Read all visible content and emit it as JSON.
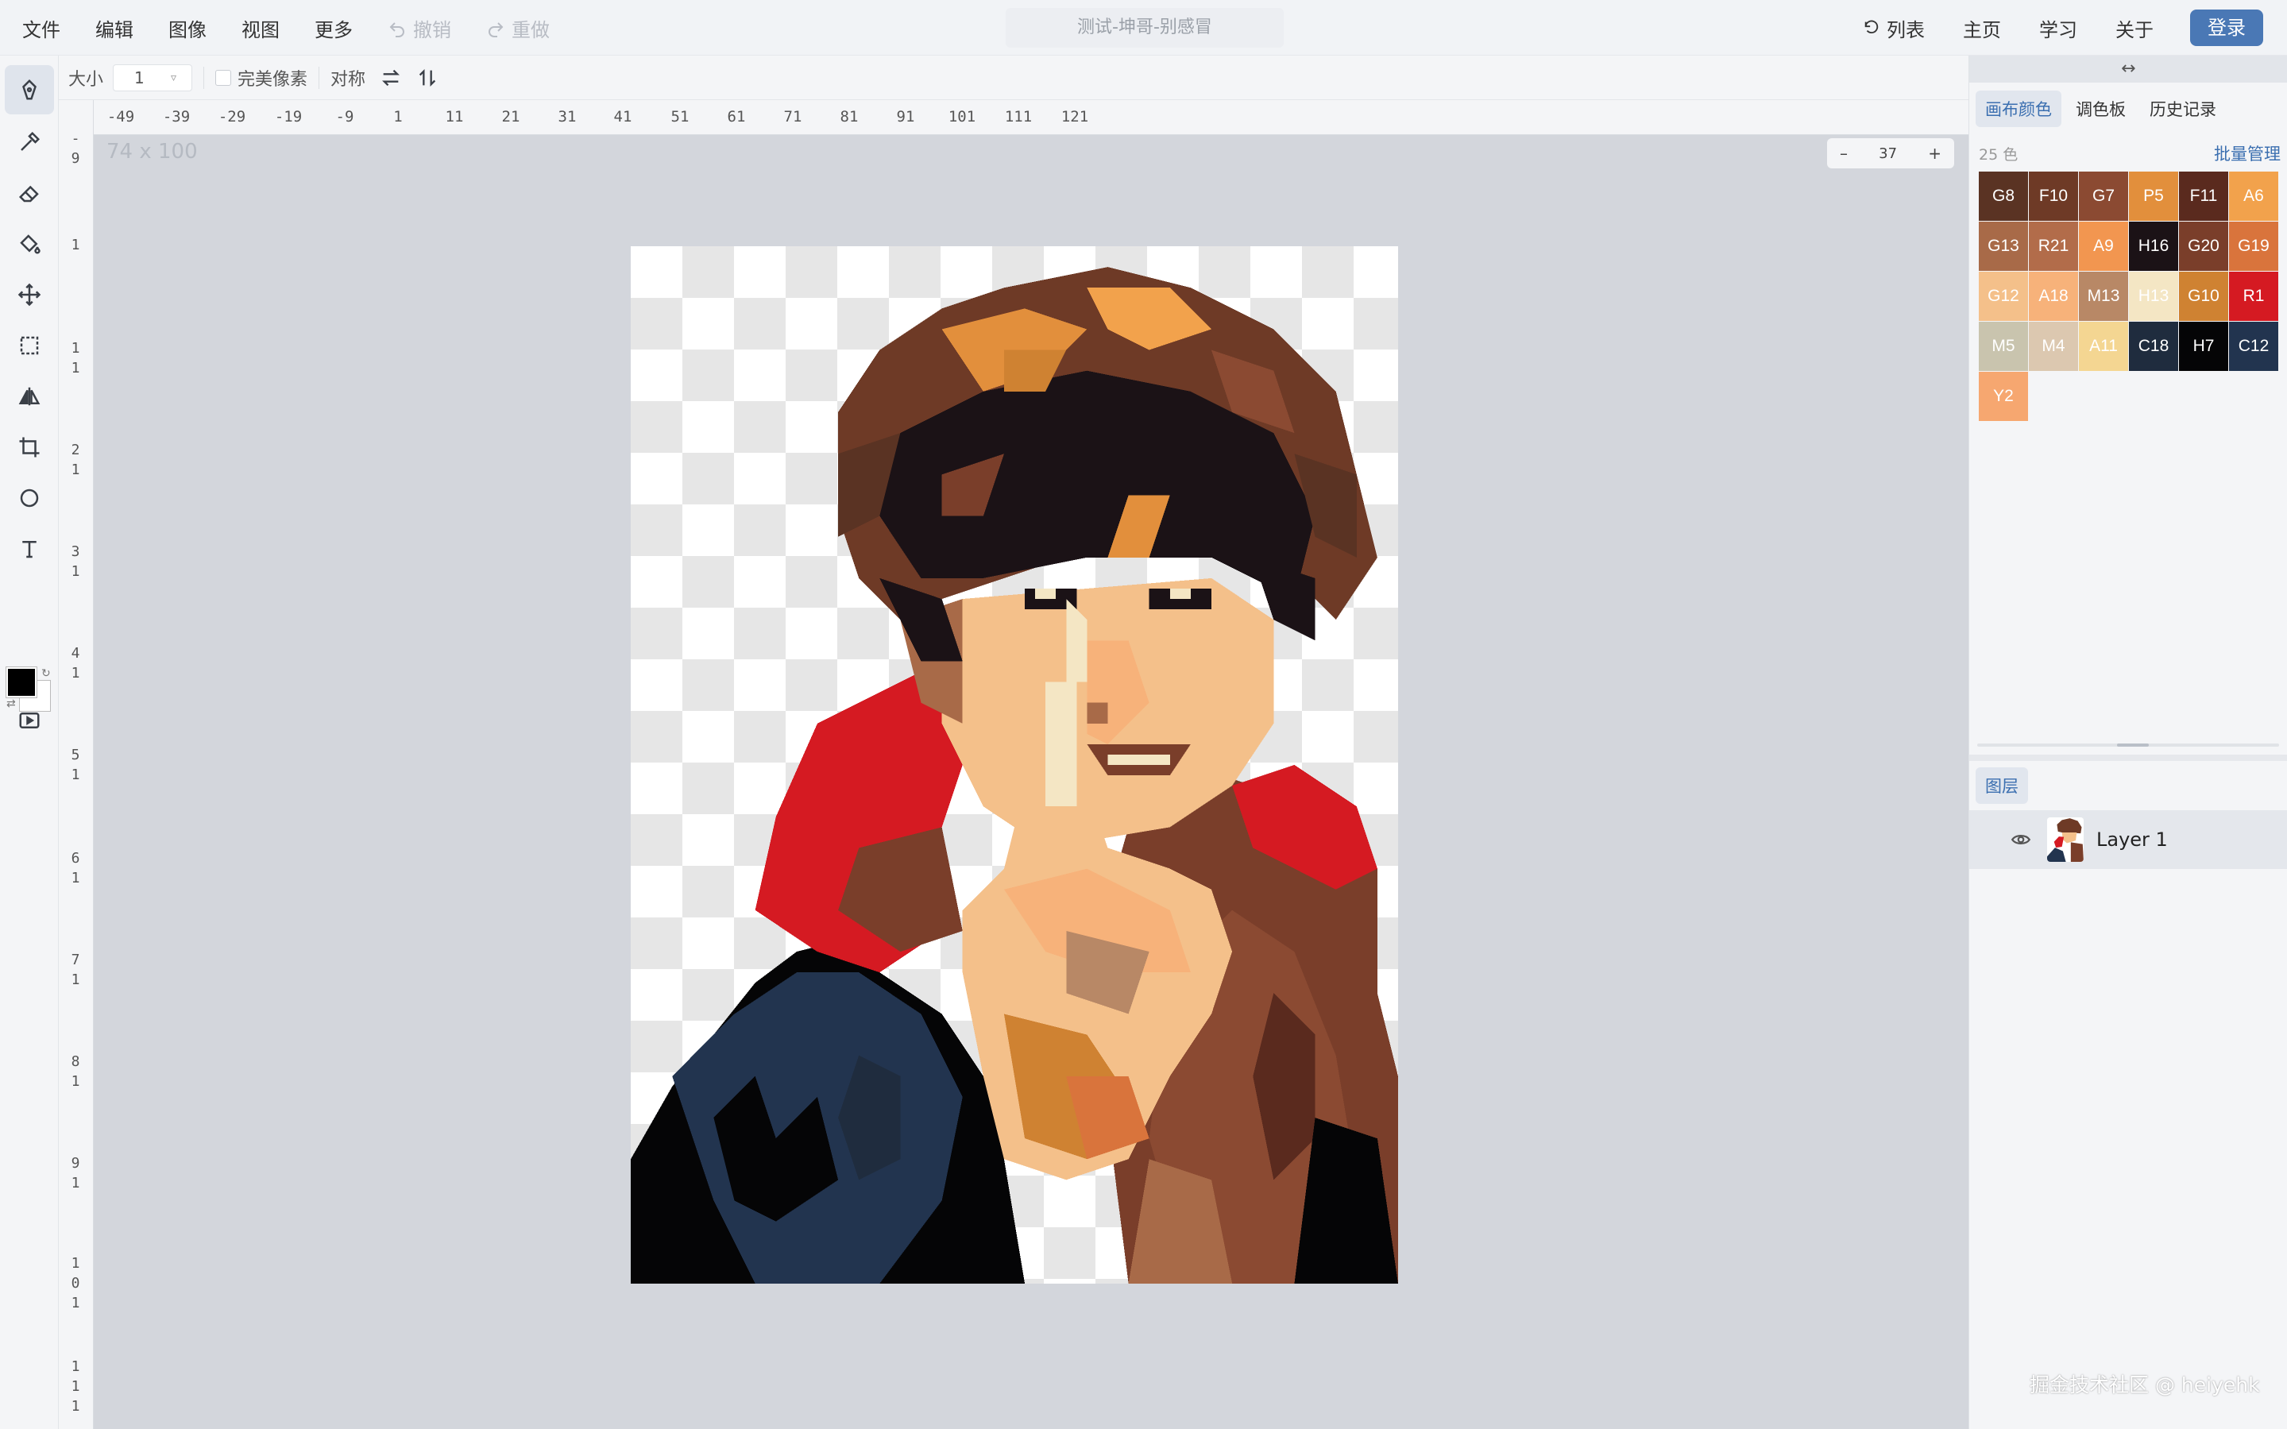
{
  "menu": {
    "file": "文件",
    "edit": "编辑",
    "image": "图像",
    "view": "视图",
    "more": "更多",
    "undo": "撤销",
    "redo": "重做"
  },
  "document_title": "测试-坤哥-别感冒",
  "nav": {
    "list": "列表",
    "home": "主页",
    "learn": "学习",
    "about": "关于",
    "login": "登录"
  },
  "options": {
    "size_label": "大小",
    "size_value": "1",
    "pixel_perfect": "完美像素",
    "symmetry": "对称"
  },
  "ruler": {
    "top": [
      "-49",
      "-39",
      "-29",
      "-19",
      "-9",
      "1",
      "11",
      "21",
      "31",
      "41",
      "51",
      "61",
      "71",
      "81",
      "91",
      "101",
      "111",
      "121"
    ],
    "left": [
      "-9",
      "1",
      "11",
      "21",
      "31",
      "41",
      "51",
      "61",
      "71",
      "81",
      "91",
      "101",
      "111"
    ]
  },
  "canvas": {
    "dimensions": "74 x 100",
    "zoom_minus": "–",
    "zoom_value": "37",
    "zoom_plus": "+"
  },
  "right_panel": {
    "collapse": "↔",
    "tabs": [
      "画布颜色",
      "调色板",
      "历史记录"
    ],
    "color_count": "25 色",
    "batch": "批量管理",
    "swatches": [
      {
        "code": "G8",
        "color": "#5a3323",
        "text": "#ffffff"
      },
      {
        "code": "F10",
        "color": "#6e3a26",
        "text": "#ffffff"
      },
      {
        "code": "G7",
        "color": "#8b4a32",
        "text": "#ffffff"
      },
      {
        "code": "P5",
        "color": "#e28f3c",
        "text": "#ffffff"
      },
      {
        "code": "F11",
        "color": "#5a2a1e",
        "text": "#ffffff"
      },
      {
        "code": "A6",
        "color": "#f2a24c",
        "text": "#ffffff"
      },
      {
        "code": "G13",
        "color": "#a86a48",
        "text": "#ffffff"
      },
      {
        "code": "R21",
        "color": "#b26c4a",
        "text": "#ffffff"
      },
      {
        "code": "A9",
        "color": "#f29650",
        "text": "#ffffff"
      },
      {
        "code": "H16",
        "color": "#1b1216",
        "text": "#ffffff"
      },
      {
        "code": "G20",
        "color": "#7a3e2a",
        "text": "#ffffff"
      },
      {
        "code": "G19",
        "color": "#d9743c",
        "text": "#ffffff"
      },
      {
        "code": "G12",
        "color": "#f4c08a",
        "text": "#ffffff"
      },
      {
        "code": "A18",
        "color": "#f7b27a",
        "text": "#ffffff"
      },
      {
        "code": "M13",
        "color": "#b88866",
        "text": "#ffffff"
      },
      {
        "code": "H13",
        "color": "#f4e6c4",
        "text": "#ffffff"
      },
      {
        "code": "G10",
        "color": "#cf8232",
        "text": "#ffffff"
      },
      {
        "code": "R1",
        "color": "#d51a22",
        "text": "#ffffff"
      },
      {
        "code": "M5",
        "color": "#c9c4ae",
        "text": "#ffffff"
      },
      {
        "code": "M4",
        "color": "#dcc8b0",
        "text": "#ffffff"
      },
      {
        "code": "A11",
        "color": "#f4d692",
        "text": "#ffffff"
      },
      {
        "code": "C18",
        "color": "#1f2c3e",
        "text": "#ffffff"
      },
      {
        "code": "H7",
        "color": "#050506",
        "text": "#ffffff"
      },
      {
        "code": "C12",
        "color": "#22344f",
        "text": "#ffffff"
      },
      {
        "code": "Y2",
        "color": "#f6a770",
        "text": "#ffffff"
      }
    ],
    "layers_tab": "图层",
    "layer_name": "Layer 1"
  },
  "watermark": "掘金技术社区 @ heiyehk",
  "colors": {
    "accent": "#4a78b5",
    "foreground_color": "#000000",
    "background_color": "#ffffff"
  }
}
